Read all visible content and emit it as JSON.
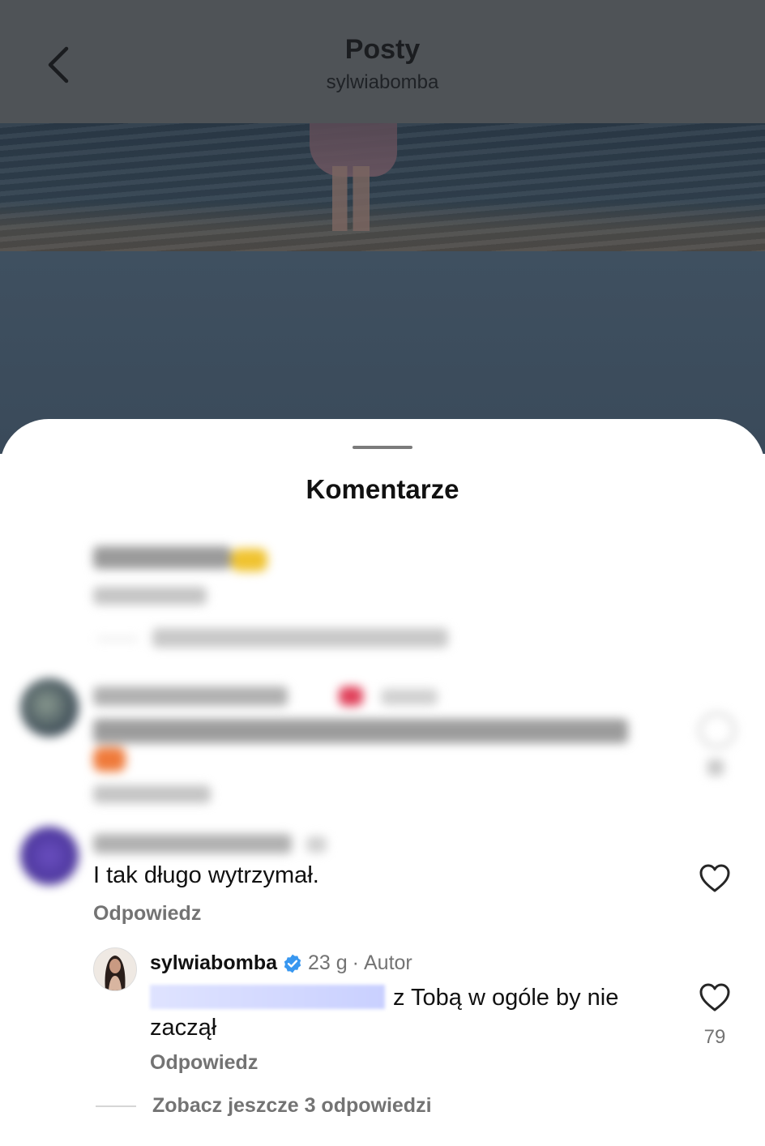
{
  "header": {
    "title": "Posty",
    "subtitle": "sylwiabomba"
  },
  "sheet": {
    "title": "Komentarze"
  },
  "comments": [
    {
      "text": "I tak długo wytrzymał.",
      "reply_label": "Odpowiedz",
      "like_icon": "heart-outline-icon"
    }
  ],
  "author_reply": {
    "username": "sylwiabomba",
    "verified_icon": "verified-badge-icon",
    "time": "23 g",
    "separator": "·",
    "badge": "Autor",
    "text": "z Tobą w ogóle by nie zaczął",
    "reply_label": "Odpowiedz",
    "like_count": "79",
    "like_icon": "heart-outline-icon"
  },
  "more_replies": "Zobacz jeszcze 3 odpowiedzi",
  "colors": {
    "verified": "#3897f0",
    "secondary_text": "#737373"
  }
}
